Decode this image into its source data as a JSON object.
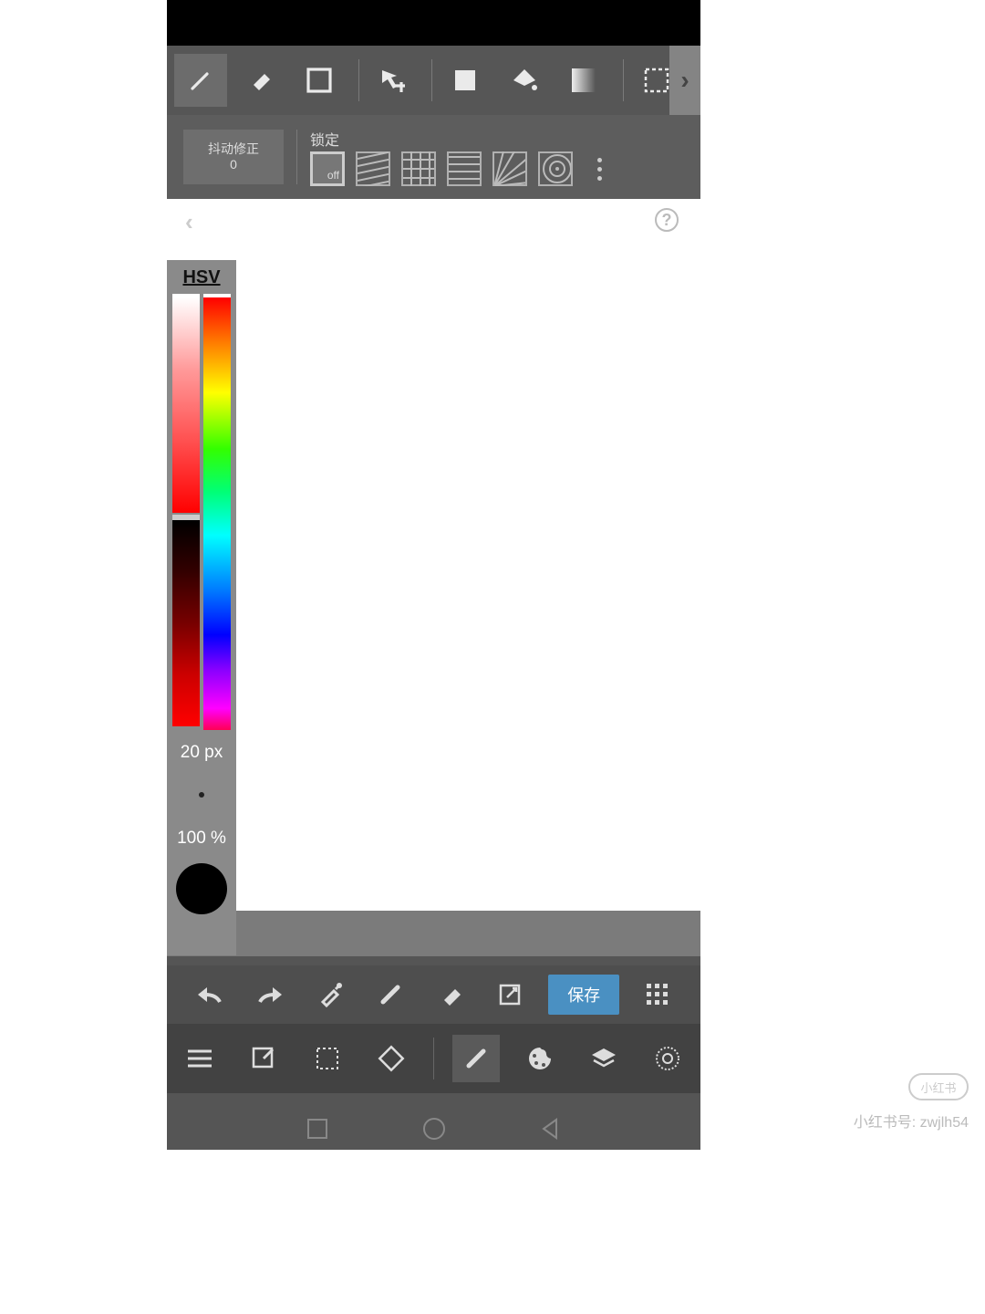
{
  "colors": {
    "accent": "#4a90c2",
    "panel": "#8a8a8a",
    "current": "#000000"
  },
  "toolbar": {
    "scroll_more": "›"
  },
  "options": {
    "jitter_label": "抖动修正",
    "jitter_value": "0",
    "lock_label": "锁定",
    "off_label": "off"
  },
  "canvas": {
    "back": "‹",
    "help": "?"
  },
  "colorpanel": {
    "mode": "HSV",
    "brush_size": "20 px",
    "opacity": "100 %"
  },
  "actions": {
    "save": "保存"
  },
  "watermark": {
    "pill": "小红书",
    "text": "小红书号: zwjlh54"
  }
}
